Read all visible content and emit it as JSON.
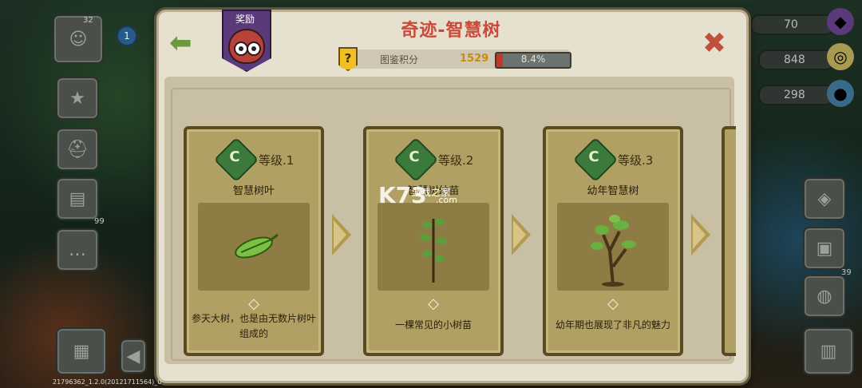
{
  "reward": {
    "label": "奖励"
  },
  "title": "奇迹-智慧树",
  "score": {
    "label": "图鉴积分",
    "value": "1529",
    "progress_text": "8.4%",
    "progress": 0.084
  },
  "resources": [
    {
      "value": "70"
    },
    {
      "value": "848"
    },
    {
      "value": "298"
    }
  ],
  "left_menu": {
    "badge_top": "32",
    "badge_small": "1",
    "count_99": "99"
  },
  "right_badge": "39",
  "cards": [
    {
      "level": "等级.1",
      "letter": "C",
      "name": "智慧树叶",
      "desc": "参天大树，也是由无数片树叶组成的"
    },
    {
      "level": "等级.2",
      "letter": "C",
      "name": "智慧树幼苗",
      "desc": "一棵常见的小树苗"
    },
    {
      "level": "等级.3",
      "letter": "C",
      "name": "幼年智慧树",
      "desc": "幼年期也展现了非凡的魅力"
    }
  ],
  "watermark": {
    "main": "K73",
    "sub": "游戏之家",
    "domain": ".com"
  },
  "build_info": "21796362_1.2.0(20121711564)_0",
  "colors": {
    "title": "#c94a3a",
    "score_value": "#c98b14",
    "progress_fill": "#c0392b",
    "card_bg": "#b0a063"
  }
}
